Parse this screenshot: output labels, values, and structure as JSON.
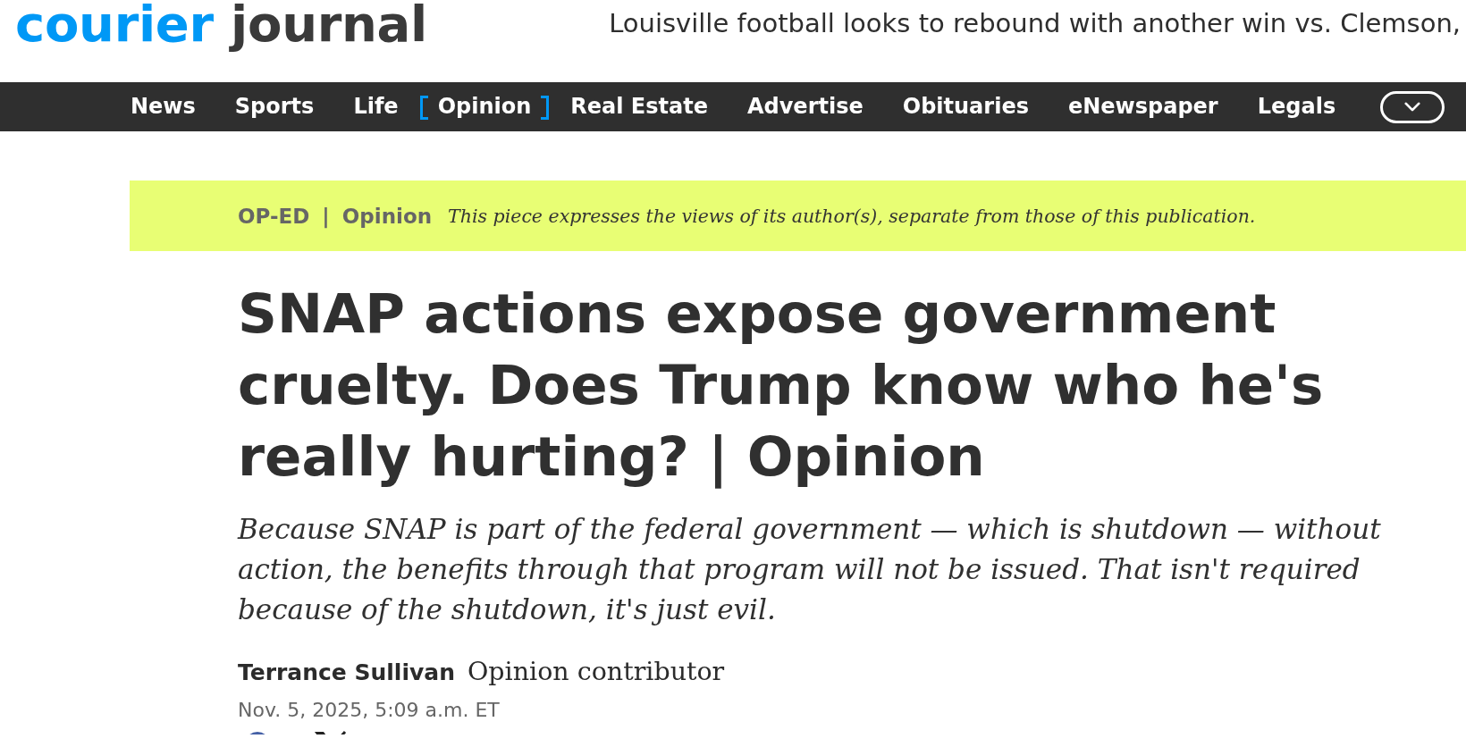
{
  "logo": {
    "part_1": "courier",
    "part_2": "journal"
  },
  "top_headline": "Louisville football looks to rebound with another win vs. Clemson,",
  "nav": {
    "items": [
      {
        "label": "News",
        "selected": false
      },
      {
        "label": "Sports",
        "selected": false
      },
      {
        "label": "Life",
        "selected": false
      },
      {
        "label": "Opinion",
        "selected": true
      },
      {
        "label": "Real Estate",
        "selected": false
      },
      {
        "label": "Advertise",
        "selected": false
      },
      {
        "label": "Obituaries",
        "selected": false
      },
      {
        "label": "eNewspaper",
        "selected": false
      },
      {
        "label": "Legals",
        "selected": false
      }
    ]
  },
  "banner": {
    "label": "OP-ED | Opinion",
    "disclaimer": "This piece expresses the views of its author(s), separate from those of this publication."
  },
  "article": {
    "headline": "SNAP actions expose government cruelty. Does Trump know who he's really hurting? | Opinion",
    "dek": "Because SNAP is part of the federal government — which is shutdown — without action, the benefits through that program will not be issued. That isn't required because of the shutdown, it's just evil.",
    "byline": {
      "author": "Terrance Sullivan",
      "role": "Opinion contributor"
    },
    "date": "Nov. 5, 2025, 5:09 a.m. ET"
  }
}
